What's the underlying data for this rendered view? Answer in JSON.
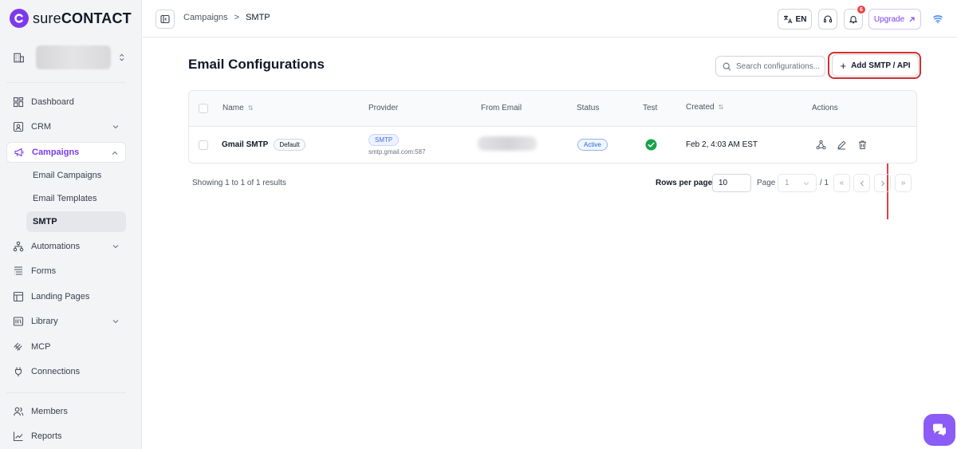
{
  "brand": {
    "prefix": "sure",
    "name": "CONTACT",
    "accent": "#7c3aed"
  },
  "sidebar": {
    "items": [
      {
        "label": "Dashboard",
        "icon": "dashboard-icon"
      },
      {
        "label": "CRM",
        "icon": "crm-icon",
        "expandable": true
      },
      {
        "label": "Campaigns",
        "icon": "megaphone-icon",
        "expandable": true,
        "expanded": true,
        "active": true
      },
      {
        "label": "Automations",
        "icon": "automations-icon",
        "expandable": true
      },
      {
        "label": "Forms",
        "icon": "forms-icon"
      },
      {
        "label": "Landing Pages",
        "icon": "landing-pages-icon"
      },
      {
        "label": "Library",
        "icon": "library-icon",
        "expandable": true
      },
      {
        "label": "MCP",
        "icon": "mcp-icon"
      },
      {
        "label": "Connections",
        "icon": "plug-icon"
      },
      {
        "label": "Members",
        "icon": "members-icon"
      },
      {
        "label": "Reports",
        "icon": "reports-icon"
      }
    ],
    "campaign_subitems": [
      {
        "label": "Email Campaigns"
      },
      {
        "label": "Email Templates"
      },
      {
        "label": "SMTP",
        "current": true
      }
    ]
  },
  "topbar": {
    "breadcrumb": [
      "Campaigns",
      "SMTP"
    ],
    "language": "EN",
    "notification_count": "6",
    "upgrade_label": "Upgrade"
  },
  "main": {
    "title": "Email Configurations",
    "search_placeholder": "Search configurations...",
    "add_button": "Add SMTP / API",
    "columns": [
      "Name",
      "Provider",
      "From Email",
      "Status",
      "Test",
      "Created",
      "Actions"
    ],
    "rows": [
      {
        "name": "Gmail SMTP",
        "default_badge": "Default",
        "provider": "SMTP",
        "provider_host": "smtp.gmail.com:587",
        "status": "Active",
        "test": "passed",
        "created": "Feb 2, 4:03 AM EST"
      }
    ],
    "footer": {
      "showing": "Showing 1 to 1 of 1 results",
      "rows_per_page_label": "Rows per page",
      "rows_per_page": "10",
      "page_label": "Page",
      "page_value": "1",
      "page_total": "/ 1"
    }
  }
}
